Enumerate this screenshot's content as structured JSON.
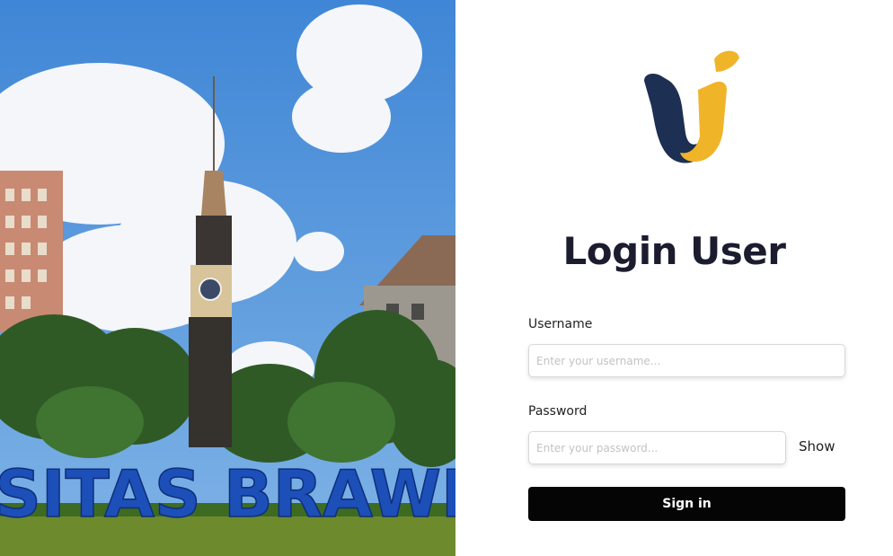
{
  "background_photo": {
    "description_icon": "campus-clock-tower-photo",
    "sign_text": "SITAS BRAWIJ"
  },
  "login": {
    "title": "Login User",
    "username_label": "Username",
    "username_placeholder": "Enter your username...",
    "username_value": "",
    "password_label": "Password",
    "password_placeholder": "Enter your password...",
    "password_value": "",
    "show_label": "Show",
    "signin_label": "Sign in"
  },
  "colors": {
    "logo_navy": "#1d2f52",
    "logo_gold": "#f0b429",
    "button_bg": "#050505",
    "title_text": "#1b1c2e"
  }
}
